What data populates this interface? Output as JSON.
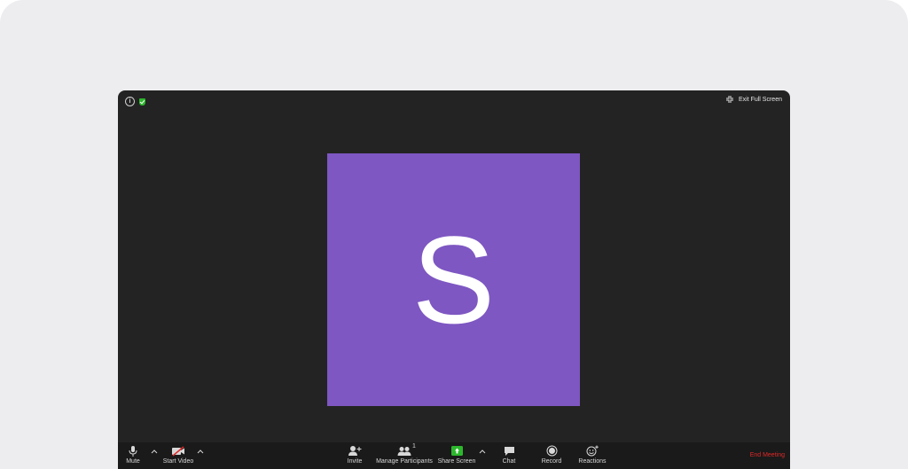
{
  "top_bar": {
    "exit_full_screen_label": "Exit Full Screen"
  },
  "participant": {
    "initial": "S",
    "tile_color": "#7e57c2"
  },
  "toolbar": {
    "mute_label": "Mute",
    "start_video_label": "Start Video",
    "invite_label": "Invite",
    "manage_participants_label": "Manage Participants",
    "participant_count": "1",
    "share_screen_label": "Share Screen",
    "chat_label": "Chat",
    "record_label": "Record",
    "reactions_label": "Reactions",
    "end_meeting_label": "End Meeting"
  },
  "colors": {
    "window_bg": "#232323",
    "toolbar_bg": "#1a1a1a",
    "share_green": "#2db72d",
    "end_red": "#e02828"
  },
  "icons": {
    "info": "info-icon",
    "encryption": "shield-icon",
    "exit_full_screen": "exit-full-screen-icon",
    "mute": "microphone-icon",
    "video": "video-off-icon",
    "invite": "add-person-icon",
    "participants": "people-icon",
    "share": "share-screen-icon",
    "chat": "chat-bubble-icon",
    "record": "record-icon",
    "reactions": "emoji-plus-icon",
    "caret": "chevron-up-icon"
  }
}
